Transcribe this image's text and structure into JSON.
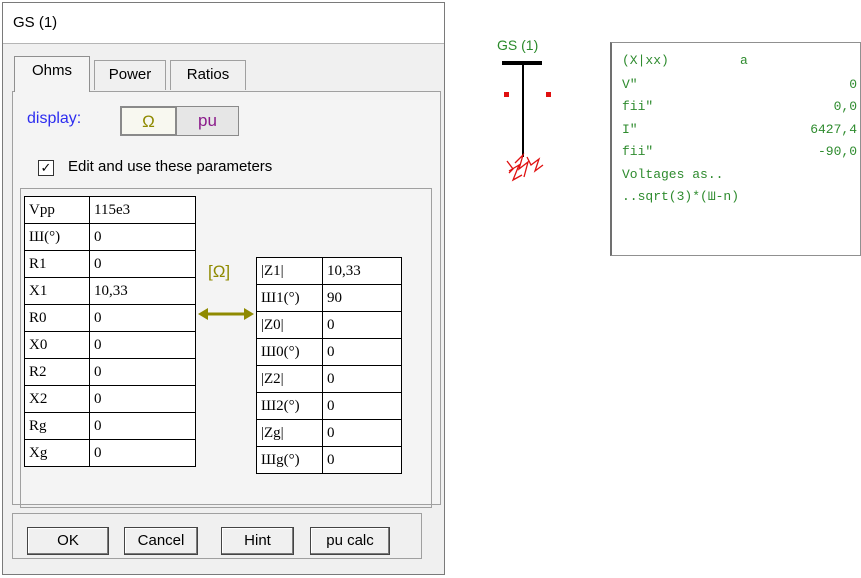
{
  "window": {
    "title": "GS (1)"
  },
  "tabs": [
    {
      "label": "Ohms",
      "active": true
    },
    {
      "label": "Power",
      "active": false
    },
    {
      "label": "Ratios",
      "active": false
    }
  ],
  "display": {
    "label": "display:",
    "options": [
      "Ω",
      "pu"
    ],
    "selected": "Ω"
  },
  "edit_checkbox": {
    "label": "Edit and use these parameters",
    "checked": true,
    "mark": "✓"
  },
  "left_params": [
    {
      "key": "Vpp",
      "value": "115e3"
    },
    {
      "key": "Ш(°)",
      "value": "0"
    },
    {
      "key": "R1",
      "value": "0"
    },
    {
      "key": "X1",
      "value": "10,33"
    },
    {
      "key": "R0",
      "value": "0"
    },
    {
      "key": "X0",
      "value": "0"
    },
    {
      "key": "R2",
      "value": "0"
    },
    {
      "key": "X2",
      "value": "0"
    },
    {
      "key": "Rg",
      "value": "0"
    },
    {
      "key": "Xg",
      "value": "0"
    }
  ],
  "unit_bracket": "[Ω]",
  "right_params": [
    {
      "key": "|Z1|",
      "value": "10,33"
    },
    {
      "key": "Ш1(°)",
      "value": "90"
    },
    {
      "key": "|Z0|",
      "value": "0"
    },
    {
      "key": "Ш0(°)",
      "value": "0"
    },
    {
      "key": "|Z2|",
      "value": "0"
    },
    {
      "key": "Ш2(°)",
      "value": "0"
    },
    {
      "key": "|Zg|",
      "value": "0"
    },
    {
      "key": "Шg(°)",
      "value": "0"
    }
  ],
  "buttons": {
    "ok": "OK",
    "cancel": "Cancel",
    "hint": "Hint",
    "pu_calc": "pu calc"
  },
  "symbol": {
    "label": "GS (1)"
  },
  "info": [
    {
      "label": "(X|xx)",
      "value": "a"
    },
    {
      "label": "V\"",
      "value": "0"
    },
    {
      "label": "fii\"",
      "value": "0,0"
    },
    {
      "label": "I\"",
      "value": "6427,4"
    },
    {
      "label": "fii\"",
      "value": "-90,0"
    },
    {
      "label": "Voltages as..",
      "value": ""
    },
    {
      "label": "..sqrt(3)*(Ш-n)",
      "value": ""
    }
  ],
  "colors": {
    "info_text": "#2e8b2e",
    "display_label": "#2d2df0",
    "ohm_accent": "#8f8a00",
    "pu_text": "#8a1a8a",
    "symbol_red": "#e01010"
  }
}
